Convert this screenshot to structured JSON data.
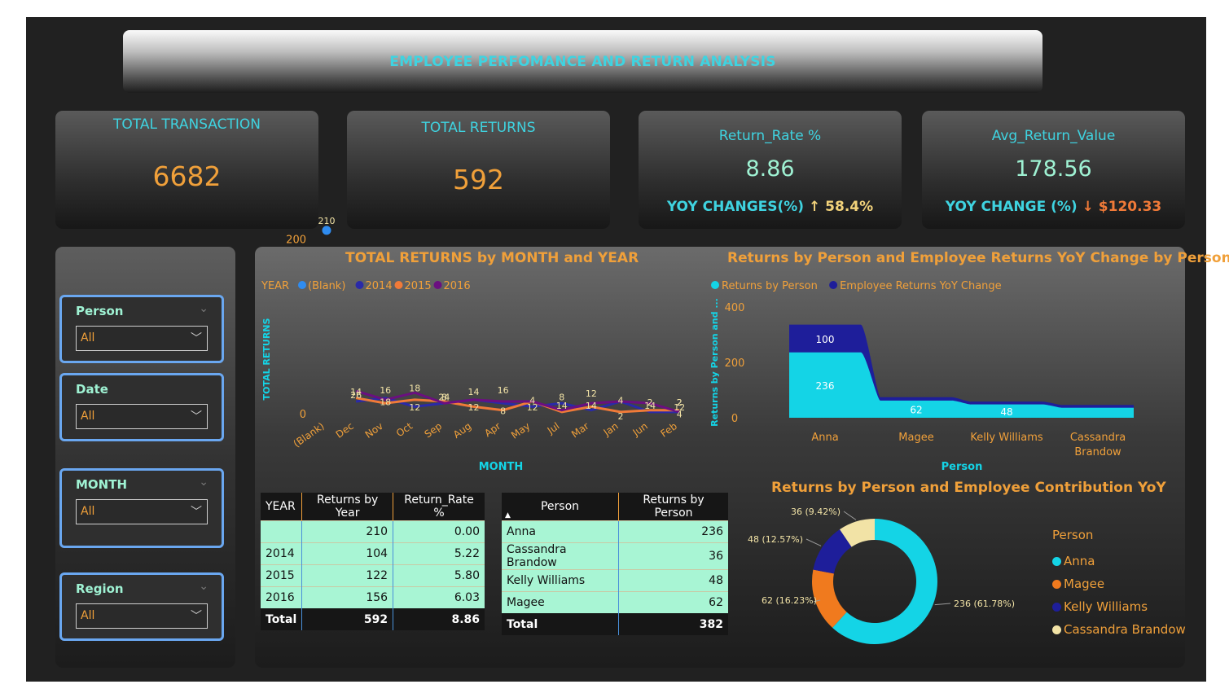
{
  "title": "EMPLOYEE PERFOMANCE AND RETURN ANALYSIS",
  "kpis": {
    "total_transaction": {
      "label": "TOTAL TRANSACTION",
      "value": "6682"
    },
    "total_returns": {
      "label": "TOTAL RETURNS",
      "value": "592"
    },
    "return_rate": {
      "label": "Return_Rate %",
      "value": "8.86",
      "yoy_label": "YOY CHANGES(%)",
      "yoy_arrow": "↑",
      "yoy_value": "58.4%"
    },
    "avg_return_value": {
      "label": "Avg_Return_Value",
      "value": "178.56",
      "yoy_label": "YOY CHANGE (%)",
      "yoy_arrow": "↓",
      "yoy_value": "$120.33"
    }
  },
  "slicers": [
    {
      "name": "Person",
      "value": "All"
    },
    {
      "name": "Date",
      "value": "All"
    },
    {
      "name": "MONTH",
      "value": "All"
    },
    {
      "name": "Region",
      "value": "All"
    }
  ],
  "year_table": {
    "headers": [
      "YEAR",
      "Returns by Year",
      "Return_Rate %"
    ],
    "rows": [
      [
        "",
        "210",
        "0.00"
      ],
      [
        "2014",
        "104",
        "5.22"
      ],
      [
        "2015",
        "122",
        "5.80"
      ],
      [
        "2016",
        "156",
        "6.03"
      ]
    ],
    "total": [
      "Total",
      "592",
      "8.86"
    ]
  },
  "person_table": {
    "headers": [
      "Person",
      "Returns by Person"
    ],
    "rows": [
      [
        "Anna",
        "236"
      ],
      [
        "Cassandra Brandow",
        "36"
      ],
      [
        "Kelly Williams",
        "48"
      ],
      [
        "Magee",
        "62"
      ]
    ],
    "total": [
      "Total",
      "382"
    ]
  },
  "chart_data": [
    {
      "type": "line",
      "title": "TOTAL RETURNS by MONTH and YEAR",
      "xlabel": "MONTH",
      "ylabel": "TOTAL RETURNS",
      "legend_title": "YEAR",
      "categories": [
        "(Blank)",
        "Dec",
        "Nov",
        "Oct",
        "Sep",
        "Aug",
        "Apr",
        "May",
        "Jul",
        "Mar",
        "Jan",
        "Jun",
        "Feb"
      ],
      "yticks": [
        0,
        200
      ],
      "ylim": [
        0,
        250
      ],
      "series": [
        {
          "name": "(Blank)",
          "color": "#2f8cf0",
          "values": [
            210,
            null,
            null,
            null,
            null,
            null,
            null,
            null,
            null,
            null,
            null,
            null,
            null
          ]
        },
        {
          "name": "2014",
          "color": "#2a2aa8",
          "values": [
            null,
            14,
            18,
            8,
            12,
            16,
            12,
            8,
            12,
            4,
            14,
            2,
            2
          ]
        },
        {
          "name": "2015",
          "color": "#f07a38",
          "values": [
            null,
            18,
            12,
            16,
            14,
            8,
            4,
            14,
            2,
            8,
            2,
            4,
            4
          ]
        },
        {
          "name": "2016",
          "color": "#6b0f80",
          "values": [
            null,
            26,
            16,
            24,
            12,
            16,
            14,
            14,
            4,
            12,
            14,
            12,
            2
          ]
        }
      ],
      "data_labels": [
        {
          "cat": 0,
          "v": 210,
          "text": "210"
        },
        {
          "cat": 1,
          "v": 26,
          "text": "26"
        },
        {
          "cat": 1,
          "v": 14,
          "text": "14"
        },
        {
          "cat": 2,
          "v": 18,
          "text": "18"
        },
        {
          "cat": 2,
          "v": 16,
          "text": "16"
        },
        {
          "cat": 3,
          "v": 12,
          "text": "12"
        },
        {
          "cat": 3,
          "v": 18,
          "text": "18"
        },
        {
          "cat": 4,
          "v": 24,
          "text": "24"
        },
        {
          "cat": 4,
          "v": 8,
          "text": "8"
        },
        {
          "cat": 5,
          "v": 12,
          "text": "12"
        },
        {
          "cat": 5,
          "v": 14,
          "text": "14"
        },
        {
          "cat": 6,
          "v": 8,
          "text": "8"
        },
        {
          "cat": 6,
          "v": 16,
          "text": "16"
        },
        {
          "cat": 7,
          "v": 12,
          "text": "12"
        },
        {
          "cat": 7,
          "v": 4,
          "text": "4"
        },
        {
          "cat": 8,
          "v": 14,
          "text": "14"
        },
        {
          "cat": 8,
          "v": 8,
          "text": "8"
        },
        {
          "cat": 9,
          "v": 14,
          "text": "14"
        },
        {
          "cat": 9,
          "v": 12,
          "text": "12"
        },
        {
          "cat": 10,
          "v": 2,
          "text": "2"
        },
        {
          "cat": 10,
          "v": 4,
          "text": "4"
        },
        {
          "cat": 11,
          "v": 14,
          "text": "14"
        },
        {
          "cat": 11,
          "v": 2,
          "text": "2"
        },
        {
          "cat": 12,
          "v": 4,
          "text": "4"
        },
        {
          "cat": 12,
          "v": 2,
          "text": "2"
        },
        {
          "cat": 12,
          "v": 12,
          "text": "12"
        },
        {
          "cat": 12,
          "v": 2,
          "text": "2"
        }
      ]
    },
    {
      "type": "area",
      "title": "Returns by Person and Employee Returns YoY Change by Person",
      "xlabel": "Person",
      "ylabel": "Returns by Person and ...",
      "categories": [
        "Anna",
        "Magee",
        "Kelly Williams",
        "Cassandra Brandow"
      ],
      "yticks": [
        0,
        200,
        400
      ],
      "ylim": [
        0,
        400
      ],
      "series": [
        {
          "name": "Returns by Person",
          "color": "#14d4e6",
          "values": [
            236,
            62,
            48,
            36
          ]
        },
        {
          "name": "Employee Returns YoY Change",
          "color": "#1e1e9a",
          "values": [
            100,
            12,
            10,
            10
          ]
        }
      ],
      "value_labels": [
        "236",
        "62",
        "48",
        ""
      ],
      "change_labels": [
        "100",
        "",
        "",
        ""
      ]
    },
    {
      "type": "pie",
      "title": "Returns by Person and Employee Contribution YoY",
      "legend_title": "Person",
      "slices": [
        {
          "name": "Anna",
          "value": 236,
          "label": "236 (61.78%)",
          "color": "#14d4e6"
        },
        {
          "name": "Magee",
          "value": 62,
          "label": "62 (16.23%)",
          "color": "#f07a1e"
        },
        {
          "name": "Kelly Williams",
          "value": 48,
          "label": "48 (12.57%)",
          "color": "#1e1e9a"
        },
        {
          "name": "Cassandra Brandow",
          "value": 36,
          "label": "36 (9.42%)",
          "color": "#f2e3a6"
        }
      ]
    }
  ]
}
